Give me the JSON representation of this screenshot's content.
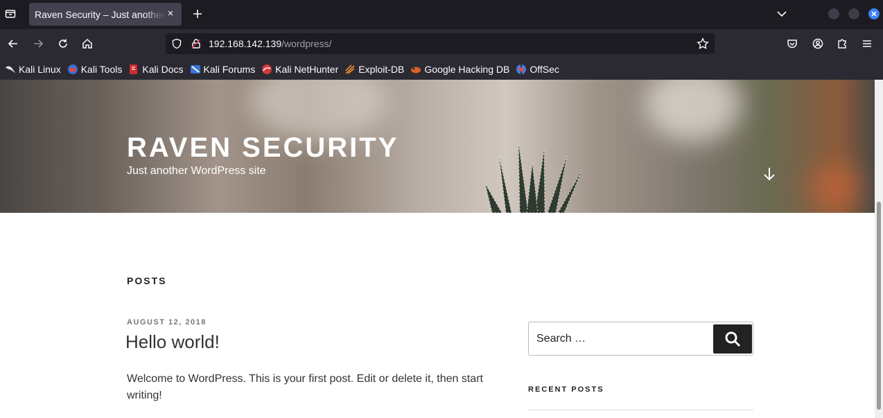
{
  "browser": {
    "tab_title": "Raven Security – Just another WordPress site",
    "close_glyph": "×",
    "new_tab_glyph": "+",
    "url_host": "192.168.142.139",
    "url_path": "/wordpress/"
  },
  "bookmarks": [
    {
      "label": "Kali Linux",
      "icon": "kali-dragon-icon",
      "color": "#dfe3ea"
    },
    {
      "label": "Kali Tools",
      "icon": "kali-tools-icon",
      "color": "#3b6fd4"
    },
    {
      "label": "Kali Docs",
      "icon": "kali-docs-icon",
      "color": "#d02c2c"
    },
    {
      "label": "Kali Forums",
      "icon": "kali-forums-icon",
      "color": "#3a76d8"
    },
    {
      "label": "Kali NetHunter",
      "icon": "nethunter-icon",
      "color": "#d23a3a"
    },
    {
      "label": "Exploit-DB",
      "icon": "exploit-db-icon",
      "color": "#e8892a"
    },
    {
      "label": "Google Hacking DB",
      "icon": "ghdb-icon",
      "color": "#d9622b"
    },
    {
      "label": "OffSec",
      "icon": "offsec-icon",
      "color": "#4a7bd6"
    }
  ],
  "site": {
    "title": "RAVEN SECURITY",
    "tagline": "Just another WordPress site"
  },
  "main": {
    "section_title": "POSTS",
    "post": {
      "date": "AUGUST 12, 2018",
      "title": "Hello world!",
      "excerpt": "Welcome to WordPress. This is your first post. Edit or delete it, then start writing!"
    }
  },
  "sidebar": {
    "search_placeholder": "Search …",
    "recent_posts_title": "RECENT POSTS"
  },
  "colors": {
    "chrome_dark": "#1c1b22",
    "chrome_toolbar": "#2b2a33",
    "close_button": "#3b82f6",
    "search_button": "#222222"
  }
}
